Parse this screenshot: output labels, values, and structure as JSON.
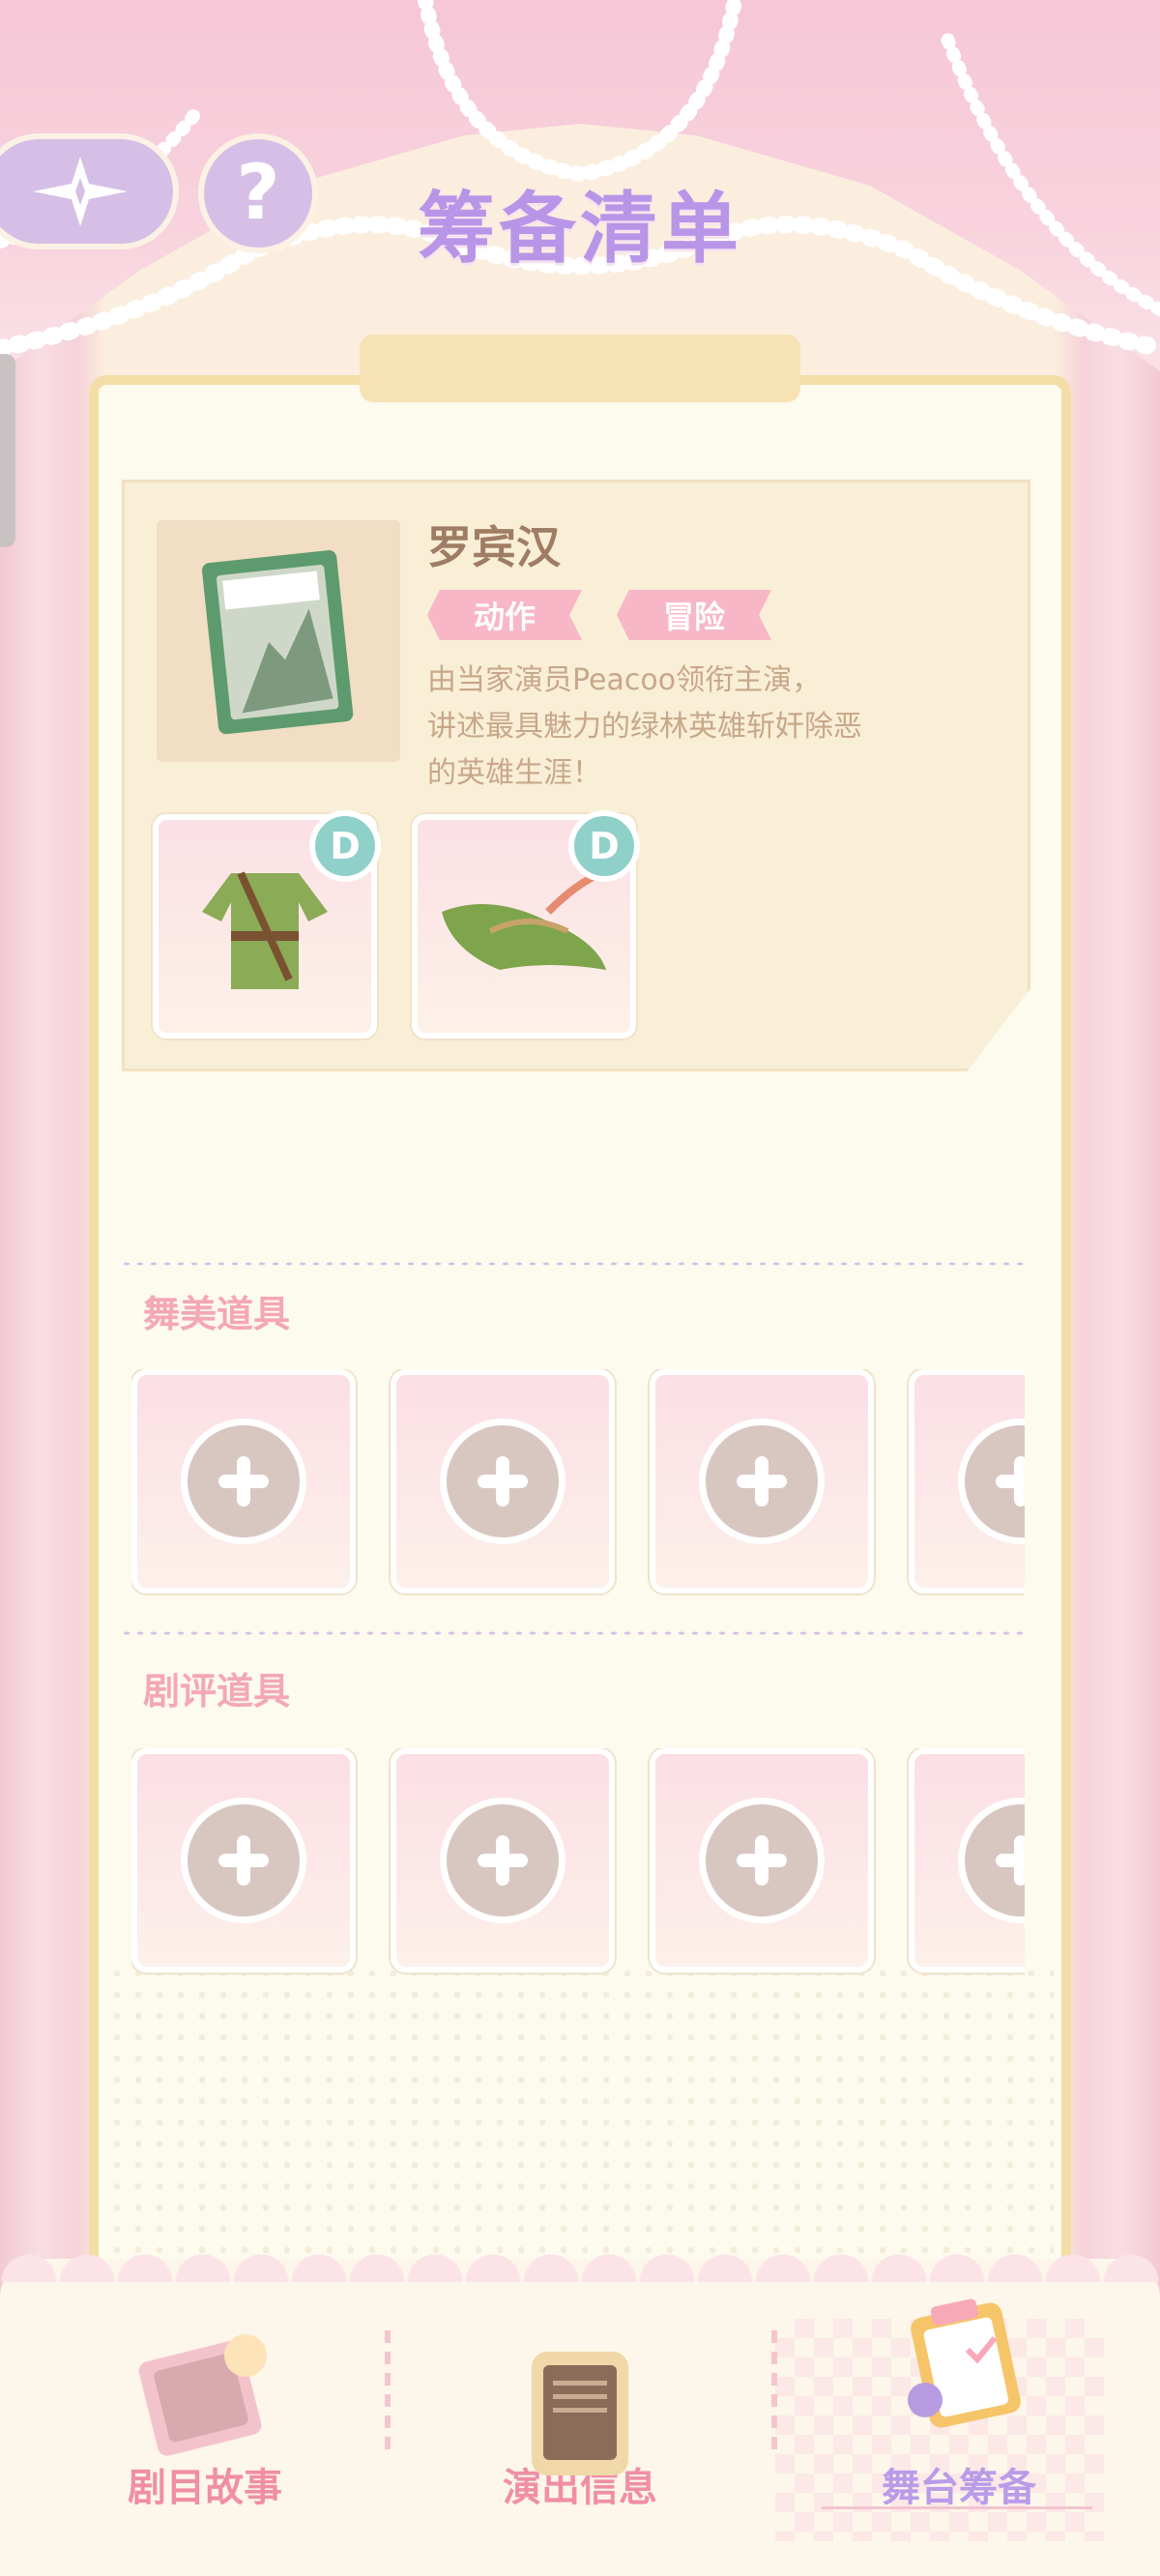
{
  "header": {
    "title": "筹备清单",
    "back_icon": "four-point-star-back-icon",
    "help_label": "?"
  },
  "play": {
    "name": "罗宾汉",
    "cover_title": "罗宾汉",
    "tags": [
      "动作",
      "冒险"
    ],
    "description_lines": [
      "由当家演员Peacoo领衔主演，",
      "讲述最具魅力的绿林英雄斩奸除恶",
      "的英雄生涯！"
    ],
    "costumes": [
      {
        "icon": "green-tunic-outfit-icon",
        "grade": "D"
      },
      {
        "icon": "green-feather-hat-icon",
        "grade": "D"
      }
    ]
  },
  "sections": [
    {
      "label": "舞美道具",
      "slots": 4
    },
    {
      "label": "剧评道具",
      "slots": 4
    }
  ],
  "bottom_nav": {
    "items": [
      {
        "label": "剧目故事",
        "icon": "storybook-icon",
        "active": false
      },
      {
        "label": "演出信息",
        "icon": "notice-board-icon",
        "active": false
      },
      {
        "label": "舞台筹备",
        "icon": "clipboard-checklist-icon",
        "active": true
      }
    ]
  },
  "colors": {
    "accent_purple": "#b995e8",
    "accent_pink": "#f08fa4",
    "panel_border": "#f4dea8",
    "grade_badge": "#8fd0c9"
  }
}
